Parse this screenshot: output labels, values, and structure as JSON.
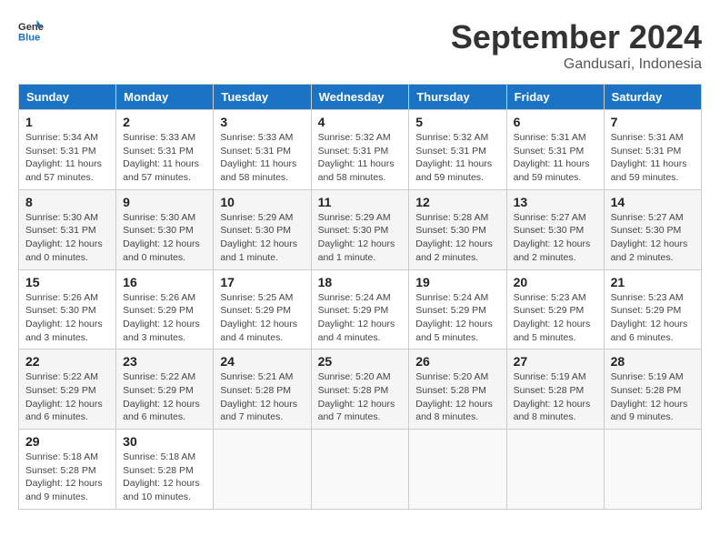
{
  "header": {
    "logo_line1": "General",
    "logo_line2": "Blue",
    "month_title": "September 2024",
    "location": "Gandusari, Indonesia"
  },
  "weekdays": [
    "Sunday",
    "Monday",
    "Tuesday",
    "Wednesday",
    "Thursday",
    "Friday",
    "Saturday"
  ],
  "weeks": [
    [
      {
        "day": "1",
        "info": "Sunrise: 5:34 AM\nSunset: 5:31 PM\nDaylight: 11 hours\nand 57 minutes."
      },
      {
        "day": "2",
        "info": "Sunrise: 5:33 AM\nSunset: 5:31 PM\nDaylight: 11 hours\nand 57 minutes."
      },
      {
        "day": "3",
        "info": "Sunrise: 5:33 AM\nSunset: 5:31 PM\nDaylight: 11 hours\nand 58 minutes."
      },
      {
        "day": "4",
        "info": "Sunrise: 5:32 AM\nSunset: 5:31 PM\nDaylight: 11 hours\nand 58 minutes."
      },
      {
        "day": "5",
        "info": "Sunrise: 5:32 AM\nSunset: 5:31 PM\nDaylight: 11 hours\nand 59 minutes."
      },
      {
        "day": "6",
        "info": "Sunrise: 5:31 AM\nSunset: 5:31 PM\nDaylight: 11 hours\nand 59 minutes."
      },
      {
        "day": "7",
        "info": "Sunrise: 5:31 AM\nSunset: 5:31 PM\nDaylight: 11 hours\nand 59 minutes."
      }
    ],
    [
      {
        "day": "8",
        "info": "Sunrise: 5:30 AM\nSunset: 5:31 PM\nDaylight: 12 hours\nand 0 minutes."
      },
      {
        "day": "9",
        "info": "Sunrise: 5:30 AM\nSunset: 5:30 PM\nDaylight: 12 hours\nand 0 minutes."
      },
      {
        "day": "10",
        "info": "Sunrise: 5:29 AM\nSunset: 5:30 PM\nDaylight: 12 hours\nand 1 minute."
      },
      {
        "day": "11",
        "info": "Sunrise: 5:29 AM\nSunset: 5:30 PM\nDaylight: 12 hours\nand 1 minute."
      },
      {
        "day": "12",
        "info": "Sunrise: 5:28 AM\nSunset: 5:30 PM\nDaylight: 12 hours\nand 2 minutes."
      },
      {
        "day": "13",
        "info": "Sunrise: 5:27 AM\nSunset: 5:30 PM\nDaylight: 12 hours\nand 2 minutes."
      },
      {
        "day": "14",
        "info": "Sunrise: 5:27 AM\nSunset: 5:30 PM\nDaylight: 12 hours\nand 2 minutes."
      }
    ],
    [
      {
        "day": "15",
        "info": "Sunrise: 5:26 AM\nSunset: 5:30 PM\nDaylight: 12 hours\nand 3 minutes."
      },
      {
        "day": "16",
        "info": "Sunrise: 5:26 AM\nSunset: 5:29 PM\nDaylight: 12 hours\nand 3 minutes."
      },
      {
        "day": "17",
        "info": "Sunrise: 5:25 AM\nSunset: 5:29 PM\nDaylight: 12 hours\nand 4 minutes."
      },
      {
        "day": "18",
        "info": "Sunrise: 5:24 AM\nSunset: 5:29 PM\nDaylight: 12 hours\nand 4 minutes."
      },
      {
        "day": "19",
        "info": "Sunrise: 5:24 AM\nSunset: 5:29 PM\nDaylight: 12 hours\nand 5 minutes."
      },
      {
        "day": "20",
        "info": "Sunrise: 5:23 AM\nSunset: 5:29 PM\nDaylight: 12 hours\nand 5 minutes."
      },
      {
        "day": "21",
        "info": "Sunrise: 5:23 AM\nSunset: 5:29 PM\nDaylight: 12 hours\nand 6 minutes."
      }
    ],
    [
      {
        "day": "22",
        "info": "Sunrise: 5:22 AM\nSunset: 5:29 PM\nDaylight: 12 hours\nand 6 minutes."
      },
      {
        "day": "23",
        "info": "Sunrise: 5:22 AM\nSunset: 5:29 PM\nDaylight: 12 hours\nand 6 minutes."
      },
      {
        "day": "24",
        "info": "Sunrise: 5:21 AM\nSunset: 5:28 PM\nDaylight: 12 hours\nand 7 minutes."
      },
      {
        "day": "25",
        "info": "Sunrise: 5:20 AM\nSunset: 5:28 PM\nDaylight: 12 hours\nand 7 minutes."
      },
      {
        "day": "26",
        "info": "Sunrise: 5:20 AM\nSunset: 5:28 PM\nDaylight: 12 hours\nand 8 minutes."
      },
      {
        "day": "27",
        "info": "Sunrise: 5:19 AM\nSunset: 5:28 PM\nDaylight: 12 hours\nand 8 minutes."
      },
      {
        "day": "28",
        "info": "Sunrise: 5:19 AM\nSunset: 5:28 PM\nDaylight: 12 hours\nand 9 minutes."
      }
    ],
    [
      {
        "day": "29",
        "info": "Sunrise: 5:18 AM\nSunset: 5:28 PM\nDaylight: 12 hours\nand 9 minutes."
      },
      {
        "day": "30",
        "info": "Sunrise: 5:18 AM\nSunset: 5:28 PM\nDaylight: 12 hours\nand 10 minutes."
      },
      {
        "day": "",
        "info": ""
      },
      {
        "day": "",
        "info": ""
      },
      {
        "day": "",
        "info": ""
      },
      {
        "day": "",
        "info": ""
      },
      {
        "day": "",
        "info": ""
      }
    ]
  ]
}
